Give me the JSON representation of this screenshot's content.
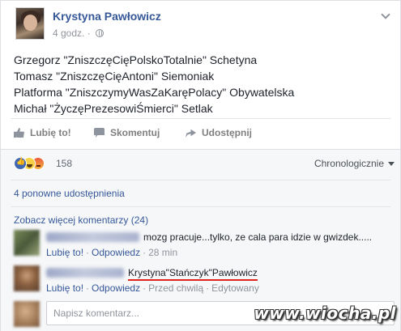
{
  "post": {
    "author": "Krystyna Pawłowicz",
    "time": "4 godz.",
    "meta_separator": "·",
    "lines": [
      "Grzegorz \"ZniszczęCięPolskoTotalnie\" Schetyna",
      "Tomasz \"ZniszczęCięAntoni\" Siemoniak",
      "Platforma \"ZniszczymyWasZaKaręPolacy\" Obywatelska",
      "Michał \"ŻyczęPrezesowiŚmierci\" Setlak"
    ]
  },
  "actions": {
    "like": "Lubię to!",
    "comment": "Skomentuj",
    "share": "Udostępnij"
  },
  "reactions": {
    "count": "158",
    "types": [
      "like",
      "haha",
      "angry"
    ]
  },
  "sort": {
    "selected": "Chronologicznie"
  },
  "shares": {
    "text": "4 ponowne udostępnienia"
  },
  "more_comments": {
    "text": "Zobacz więcej komentarzy (24)"
  },
  "comments": [
    {
      "text": "mozg pracuje...tylko, ze cala para idzie w gwizdek.....",
      "like": "Lubię to!",
      "reply": "Odpowiedz",
      "time": "28 min",
      "edited": ""
    },
    {
      "text": "Krystyna\"Stańczyk\"Pawłowicz",
      "like": "Lubię to!",
      "reply": "Odpowiedz",
      "time": "Przed chwilą",
      "edited": "Edytowany"
    }
  ],
  "compose": {
    "placeholder": "Napisz komentarz..."
  },
  "watermark": "www.wiocha.pl",
  "colors": {
    "link": "#365899",
    "meta": "#90949c",
    "underline": "#e0231b",
    "like_reaction": "#4267b2"
  }
}
